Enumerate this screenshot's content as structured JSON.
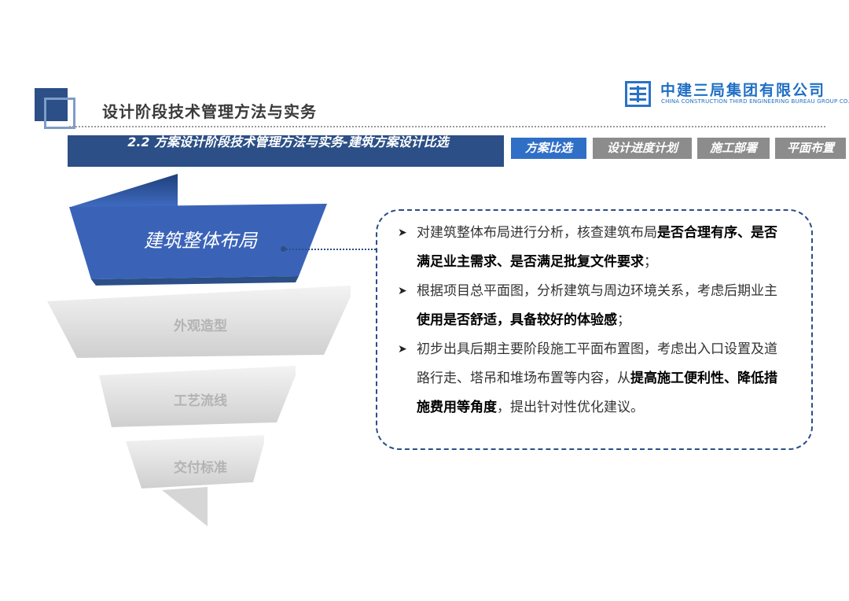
{
  "header": {
    "title": "设计阶段技术管理方法与实务",
    "company_cn": "中建三局集团有限公司",
    "company_en": "CHINA CONSTRUCTION THIRD ENGINEERING BUREAU GROUP CO.,LTD"
  },
  "section": {
    "title": "2.2  方案设计阶段技术管理方法与实务-建筑方案设计比选"
  },
  "tabs": [
    {
      "label": "方案比选",
      "active": true
    },
    {
      "label": "设计进度计划",
      "active": false
    },
    {
      "label": "施工部署",
      "active": false
    },
    {
      "label": "平面布置",
      "active": false
    }
  ],
  "funnel": {
    "items": [
      "建筑整体布局",
      "外观造型",
      "工艺流线",
      "交付标准"
    ],
    "active_color": "#3a63b8",
    "inactive_color": "#e3e3e3"
  },
  "bullets": [
    {
      "parts": [
        {
          "text": "对建筑整体布局进行分析，核查建筑布局",
          "bold": false
        },
        {
          "text": "是否合理有序、是否满足业主需求、是否满足批复文件要求",
          "bold": true
        },
        {
          "text": "；",
          "bold": false
        }
      ]
    },
    {
      "parts": [
        {
          "text": "根据项目总平面图，分析建筑与周边环境关系，考虑后期业主",
          "bold": false
        },
        {
          "text": "使用是否舒适，具备较好的体验感",
          "bold": true
        },
        {
          "text": "；",
          "bold": false
        }
      ]
    },
    {
      "parts": [
        {
          "text": "初步出具后期主要阶段施工平面布置图，考虑出入口设置及道路行走、塔吊和堆场布置等内容，从",
          "bold": false
        },
        {
          "text": "提高施工便利性、降低措施费用等角度",
          "bold": true
        },
        {
          "text": "，提出针对性优化建议。",
          "bold": false
        }
      ]
    }
  ],
  "colors": {
    "primary": "#2b4f86",
    "accent": "#2f6fc6",
    "brand": "#1f6fc4"
  }
}
